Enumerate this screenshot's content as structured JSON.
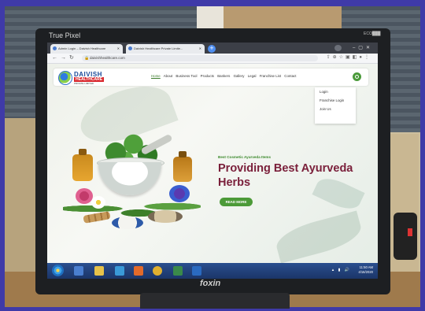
{
  "monitor": {
    "brand": "True Pixel",
    "eco_badge": "ECO███",
    "bottom_brand": "foxin"
  },
  "browser": {
    "tabs": [
      {
        "label": "Admin Login – Daivish Healthcare"
      },
      {
        "label": "Daivish Healthcare Private Limite..."
      }
    ],
    "url": "daivishhealthcare.com",
    "new_tab_label": "+"
  },
  "site": {
    "logo_title": "DAIVISH",
    "logo_sub": "HEALTHCARE",
    "logo_tag": "PRIVATE LIMITED",
    "menu": [
      "Home",
      "About",
      "Business Tool",
      "Products",
      "Bankers",
      "Gallery",
      "Legal",
      "Franchise List",
      "Contact"
    ],
    "dropdown": [
      "Login",
      "Franchise Login",
      "Join Us"
    ],
    "hero_kicker": "Best Cosmetic Ayurveda Items",
    "hero_title": "Providing Best Ayurveda Herbs",
    "read_more": "READ MORE"
  },
  "taskbar": {
    "time": "11:50 AM",
    "date": "4/16/2020"
  }
}
